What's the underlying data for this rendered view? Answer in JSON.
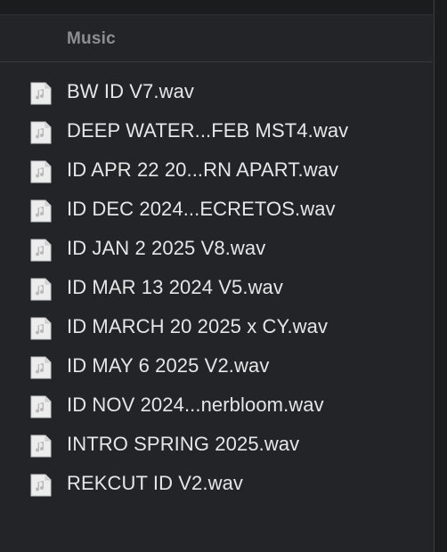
{
  "header": {
    "title": "Music"
  },
  "files": [
    {
      "name": "BW ID V7.wav",
      "icon": "audio-file-icon"
    },
    {
      "name": "DEEP WATER...FEB MST4.wav",
      "icon": "audio-file-icon"
    },
    {
      "name": "ID APR 22 20...RN APART.wav",
      "icon": "audio-file-icon"
    },
    {
      "name": "ID DEC 2024...ECRETOS.wav",
      "icon": "audio-file-icon"
    },
    {
      "name": "ID JAN 2 2025 V8.wav",
      "icon": "audio-file-icon"
    },
    {
      "name": "ID MAR 13 2024 V5.wav",
      "icon": "audio-file-icon"
    },
    {
      "name": "ID MARCH 20 2025 x CY.wav",
      "icon": "audio-file-icon"
    },
    {
      "name": "ID MAY 6 2025 V2.wav",
      "icon": "audio-file-icon"
    },
    {
      "name": "ID NOV 2024...nerbloom.wav",
      "icon": "audio-file-icon"
    },
    {
      "name": "INTRO SPRING 2025.wav",
      "icon": "audio-file-icon"
    },
    {
      "name": "REKCUT ID V2.wav",
      "icon": "audio-file-icon"
    }
  ],
  "colors": {
    "background": "#232427",
    "header_text": "#8d8e91",
    "file_text": "#e6e6e8"
  }
}
